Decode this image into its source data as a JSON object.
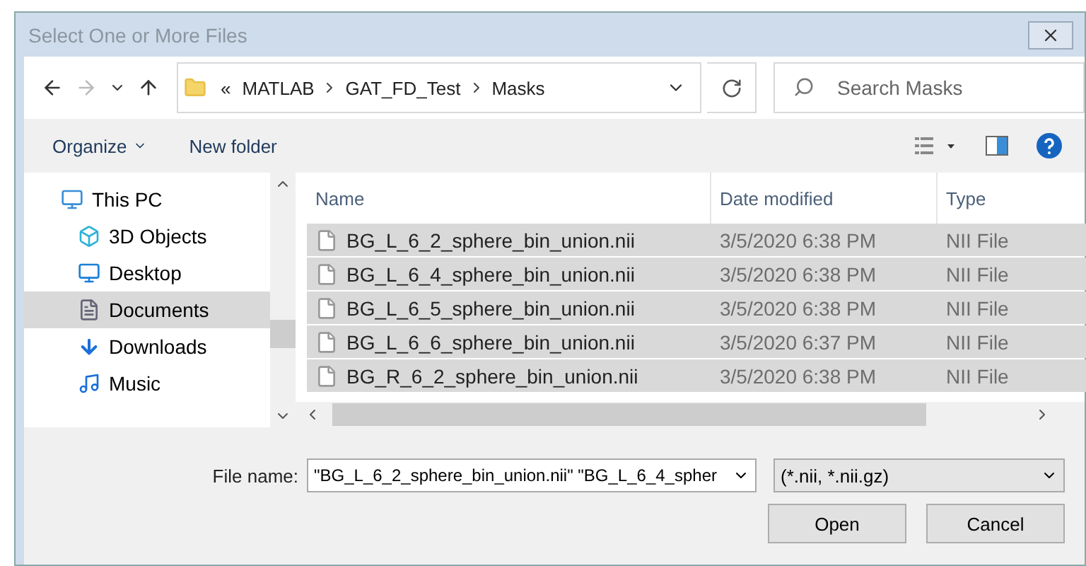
{
  "window": {
    "title": "Select One or More Files"
  },
  "address": {
    "overflow": "«",
    "crumbs": [
      "MATLAB",
      "GAT_FD_Test",
      "Masks"
    ]
  },
  "search": {
    "placeholder": "Search Masks"
  },
  "toolbar": {
    "organize": "Organize",
    "new_folder": "New folder"
  },
  "sidebar": {
    "items": [
      {
        "label": "This PC",
        "kind": "pc",
        "selected": false,
        "children": [
          {
            "label": "3D Objects",
            "kind": "cube",
            "selected": false
          },
          {
            "label": "Desktop",
            "kind": "desktop",
            "selected": false
          },
          {
            "label": "Documents",
            "kind": "documents",
            "selected": true
          },
          {
            "label": "Downloads",
            "kind": "downloads",
            "selected": false
          },
          {
            "label": "Music",
            "kind": "music",
            "selected": false
          }
        ]
      }
    ]
  },
  "table": {
    "columns": [
      "Name",
      "Date modified",
      "Type"
    ],
    "rows": [
      {
        "name": "BG_L_6_2_sphere_bin_union.nii",
        "date": "3/5/2020 6:38 PM",
        "type": "NII File",
        "selected": true
      },
      {
        "name": "BG_L_6_4_sphere_bin_union.nii",
        "date": "3/5/2020 6:38 PM",
        "type": "NII File",
        "selected": true
      },
      {
        "name": "BG_L_6_5_sphere_bin_union.nii",
        "date": "3/5/2020 6:38 PM",
        "type": "NII File",
        "selected": true
      },
      {
        "name": "BG_L_6_6_sphere_bin_union.nii",
        "date": "3/5/2020 6:37 PM",
        "type": "NII File",
        "selected": true
      },
      {
        "name": "BG_R_6_2_sphere_bin_union.nii",
        "date": "3/5/2020 6:38 PM",
        "type": "NII File",
        "selected": true
      }
    ]
  },
  "file_name": {
    "label": "File name:",
    "value": "\"BG_L_6_2_sphere_bin_union.nii\" \"BG_L_6_4_spher"
  },
  "filter": {
    "value": "(*.nii, *.nii.gz)"
  },
  "buttons": [
    "Open",
    "Cancel"
  ]
}
